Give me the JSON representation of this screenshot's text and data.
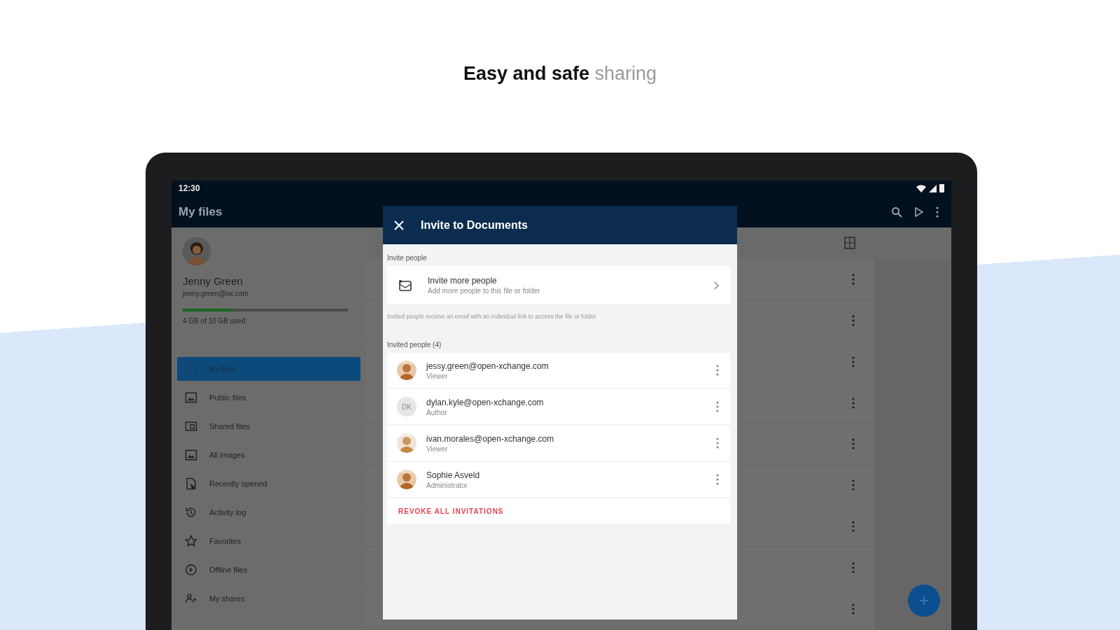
{
  "headline": "**Easy and safe** sharing",
  "status_bar": {
    "time": "12:30"
  },
  "app_bar": {
    "title": "My files"
  },
  "account": {
    "name": "Jenny Green",
    "email": "jenny.green@ox.com",
    "storage": {
      "level": 0.3
    },
    "storage_text": "4 GB of 10 GB used"
  },
  "sidebar": {
    "items": [
      {
        "label": "My files",
        "selected": true
      },
      {
        "label": "Public files",
        "selected": false
      },
      {
        "label": "Shared files",
        "selected": false
      },
      {
        "label": "All images",
        "selected": false
      },
      {
        "label": "Recently opened",
        "selected": false
      },
      {
        "label": "Activity log",
        "selected": false
      },
      {
        "label": "Favorites",
        "selected": false
      },
      {
        "label": "Offline files",
        "selected": false
      },
      {
        "label": "My shares",
        "selected": false
      }
    ]
  },
  "dialog": {
    "title": "Invite to Documents",
    "section_invite": "Invite people",
    "invite_item": {
      "title": "Invite more people",
      "subtitle": "Add more people to this file or folder"
    },
    "note": "Invited people receive an email with an individual link to access the file or folder",
    "section_invited": "Invited people (4)",
    "people": [
      {
        "email": "jessy.green@open-xchange.com",
        "role": "Viewer"
      },
      {
        "email": "dylan.kyle@open-xchange.com",
        "role": "Author",
        "avatar": {
          "kind": "initials",
          "text": "DK"
        }
      },
      {
        "email": "ivan.morales@open-xchange.com",
        "role": "Viewer"
      },
      {
        "email": "Sophie Asveld",
        "role": "Administrator"
      }
    ],
    "revoke": "REVOKE ALL INVITATIONS"
  }
}
